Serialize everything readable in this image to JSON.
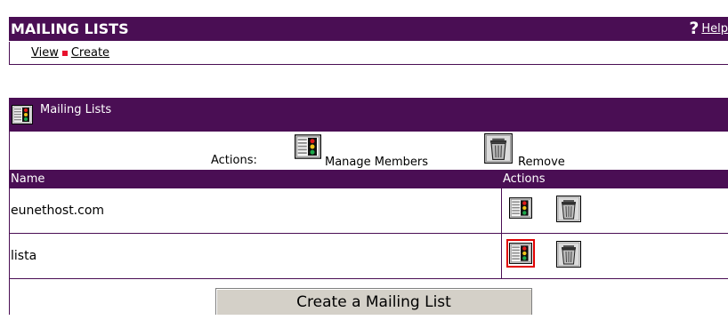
{
  "header": {
    "title": "MAILING LISTS",
    "help_label": "Help",
    "help_icon": "question-mark-icon"
  },
  "subnav": {
    "view_label": "View",
    "create_label": "Create"
  },
  "panel": {
    "title": "Mailing Lists",
    "actions_label": "Actions:",
    "manage_members_label": "Manage Members",
    "remove_label": "Remove",
    "columns": {
      "name": "Name",
      "actions": "Actions"
    },
    "rows": [
      {
        "name": "eunethost.com"
      },
      {
        "name": "lista"
      }
    ],
    "create_button_label": "Create a Mailing List"
  },
  "colors": {
    "header_purple": "#4a0e54",
    "separator_red": "#e8112d",
    "highlight_red": "#e00000"
  }
}
